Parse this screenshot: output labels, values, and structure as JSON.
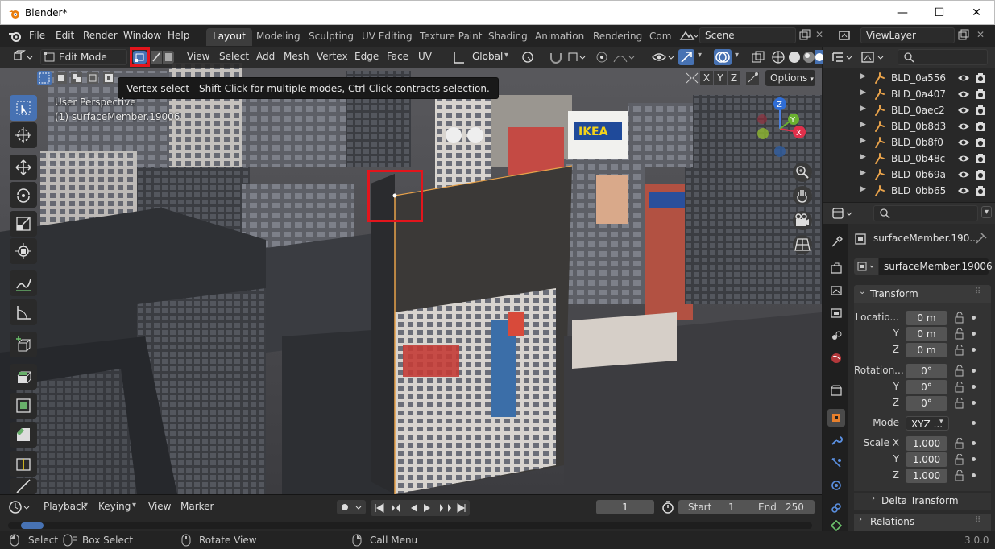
{
  "window": {
    "title": "Blender*",
    "minimize": "—",
    "maximize": "☐",
    "close": "✕"
  },
  "menubar": {
    "menus": [
      "File",
      "Edit",
      "Render",
      "Window",
      "Help"
    ],
    "workspaces": [
      "Layout",
      "Modeling",
      "Sculpting",
      "UV Editing",
      "Texture Paint",
      "Shading",
      "Animation",
      "Rendering",
      "Com"
    ],
    "active_workspace": "Layout",
    "scene": "Scene",
    "view_layer": "ViewLayer"
  },
  "viewport_header": {
    "mode": "Edit Mode",
    "menus": [
      "View",
      "Select",
      "Add",
      "Mesh",
      "Vertex",
      "Edge",
      "Face",
      "UV"
    ],
    "transform_orientation": "Global",
    "options_label": "Options",
    "axes": [
      "X",
      "Y",
      "Z"
    ]
  },
  "tooltip": "Vertex select - Shift-Click for multiple modes, Ctrl-Click contracts selection.",
  "viewport_overlay": {
    "view_name": "User Perspective",
    "object_line": "(1) surfaceMember.19006"
  },
  "gizmo": {
    "x": "X",
    "y": "Y",
    "z": "Z"
  },
  "ikea": "IKEA",
  "outliner": {
    "items": [
      "BLD_0a556",
      "BLD_0a407",
      "BLD_0aec2",
      "BLD_0b8d3",
      "BLD_0b8f0",
      "BLD_0b48c",
      "BLD_0b69a",
      "BLD_0bb65"
    ]
  },
  "properties": {
    "object_name": "surfaceMember.190...",
    "datablock_name": "surfaceMember.19006",
    "transform_label": "Transform",
    "location_label": "Locatio...",
    "rotation_label": "Rotation...",
    "mode_label": "Mode",
    "scale_label": "Scale X",
    "y_label": "Y",
    "z_label": "Z",
    "location": [
      "0 m",
      "0 m",
      "0 m"
    ],
    "rotation": [
      "0°",
      "0°",
      "0°"
    ],
    "rotation_mode": "XYZ ...",
    "scale": [
      "1.000",
      "1.000",
      "1.000"
    ],
    "delta_transform": "Delta Transform",
    "relations": "Relations"
  },
  "timeline": {
    "playback": "Playback",
    "keying": "Keying",
    "view": "View",
    "marker": "Marker",
    "current_frame": "1",
    "start_label": "Start",
    "start": "1",
    "end_label": "End",
    "end": "250"
  },
  "statusbar": {
    "select": "Select",
    "box_select": "Box Select",
    "rotate_view": "Rotate View",
    "call_menu": "Call Menu",
    "version": "3.0.0"
  },
  "colors": {
    "accent": "#4772b3",
    "highlight": "#e3151c",
    "outliner_icon": "#e8a24a"
  }
}
